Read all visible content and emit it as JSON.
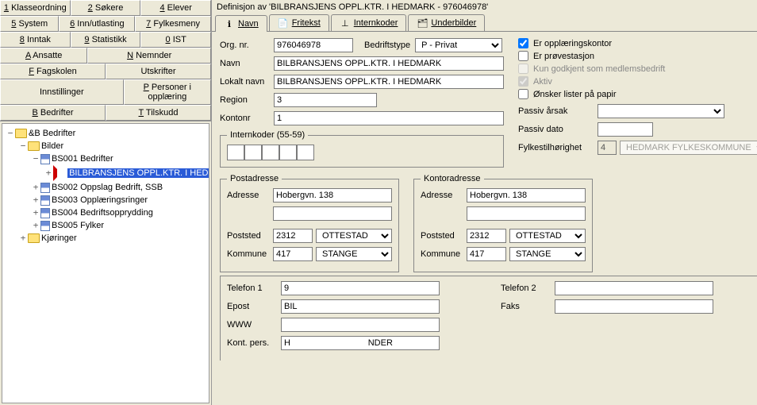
{
  "title": "Definisjon av 'BILBRANSJENS OPPL.KTR. I HEDMARK - 976046978'",
  "menu": {
    "klasse": "Klasseordning",
    "sokere": "Søkere",
    "elever": "Elever",
    "system": "System",
    "inn": "Inn/utlasting",
    "fylkes": "Fylkesmeny",
    "inntak": "Inntak",
    "stat": "Statistikk",
    "ist": "IST",
    "ansatte": "Ansatte",
    "nemnder": "Nemnder",
    "fagskolen": "Fagskolen",
    "utskrifter": "Utskrifter",
    "innstillinger": "Innstillinger",
    "personer": "Personer i opplæring",
    "bedrifter": "Bedrifter",
    "tilskudd": "Tilskudd"
  },
  "tree": {
    "root": "&B Bedrifter",
    "bilder": "Bilder",
    "bs001": "BS001 Bedrifter",
    "sel": "BILBRANSJENS OPPL.KTR. I HED",
    "bs002": "BS002 Oppslag Bedrift, SSB",
    "bs003": "BS003 Opplæringsringer",
    "bs004": "BS004 Bedriftsopprydding",
    "bs005": "BS005 Fylker",
    "kjoringer": "Kjøringer"
  },
  "tabs": {
    "navn": "Navn",
    "fritekst": "Fritekst",
    "internkoder": "Internkoder",
    "underbilder": "Underbilder"
  },
  "labels": {
    "orgnr": "Org. nr.",
    "bedriftstype": "Bedriftstype",
    "navn": "Navn",
    "lokaltnavn": "Lokalt navn",
    "region": "Region",
    "kontonr": "Kontonr",
    "internkoder": "Internkoder (55-59)",
    "postadresse": "Postadresse",
    "kontoradresse": "Kontoradresse",
    "adresse": "Adresse",
    "poststed": "Poststed",
    "kommune": "Kommune",
    "telefon1": "Telefon 1",
    "telefon2": "Telefon 2",
    "epost": "Epost",
    "faks": "Faks",
    "www": "WWW",
    "kontpers": "Kont. pers.",
    "opplkontor": "Er opplæringskontor",
    "provestasjon": "Er prøvestasjon",
    "kungodkjent": "Kun godkjent som medlemsbedrift",
    "aktiv": "Aktiv",
    "onskerlister": "Ønsker lister på papir",
    "passivarsak": "Passiv årsak",
    "passivdato": "Passiv dato",
    "fylkest": "Fylkestilhørighet"
  },
  "values": {
    "orgnr": "976046978",
    "bedriftstype": "P - Privat",
    "navn": "BILBRANSJENS OPPL.KTR. I HEDMARK",
    "lokaltnavn": "BILBRANSJENS OPPL.KTR. I HEDMARK",
    "region": "3",
    "kontonr": "1",
    "fylkesnr": "4",
    "fylkesnavn": "HEDMARK FYLKESKOMMUNE",
    "post_adresse": "Hobergvn. 138",
    "post_nr": "2312",
    "post_sted": "OTTESTAD",
    "post_komnr": "417",
    "post_kom": "STANGE",
    "kont_adresse": "Hobergvn. 138",
    "kont_nr": "2312",
    "kont_sted": "OTTESTAD",
    "kont_komnr": "417",
    "kont_kom": "STANGE",
    "telefon1": "9",
    "epost": "BIL",
    "kontpers": "H                                NDER"
  },
  "checks": {
    "opplkontor": true,
    "provestasjon": false,
    "kungodkjent": false,
    "aktiv": true,
    "onskerlister": false
  }
}
